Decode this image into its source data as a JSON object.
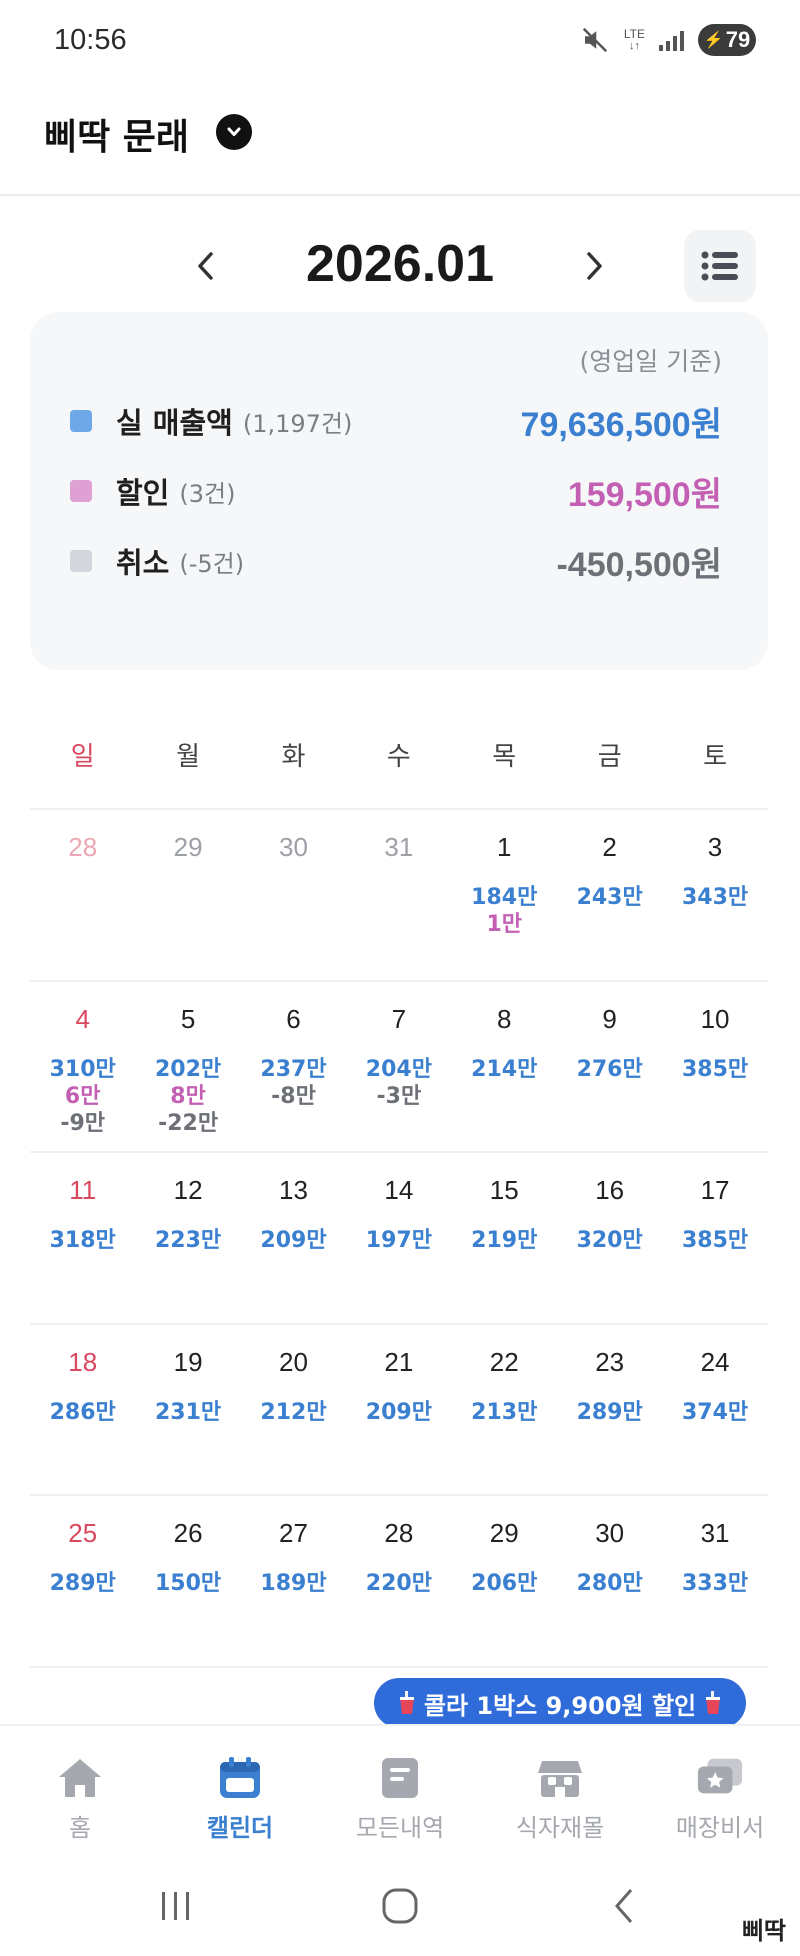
{
  "status_bar": {
    "time": "10:56",
    "network": "LTE",
    "battery": "79",
    "icons": [
      "mute-icon",
      "lte-icon",
      "signal-icon",
      "battery-charging-icon"
    ]
  },
  "header": {
    "store_name": "삐딱 문래",
    "toggle_icon": "chevron-down-icon"
  },
  "month_nav": {
    "label": "2026.01",
    "prev_icon": "chevron-left-icon",
    "next_icon": "chevron-right-icon",
    "list_icon": "list-view-icon"
  },
  "summary": {
    "note": "(영업일 기준)",
    "rows": [
      {
        "label": "실 매출액",
        "count": "(1,197건)",
        "value": "79,636,500원",
        "color": "#3a7fd0",
        "swatch": "#6ea8e8"
      },
      {
        "label": "할인",
        "count": "(3건)",
        "value": "159,500원",
        "color": "#c360b4",
        "swatch": "#dfa0d4"
      },
      {
        "label": "취소",
        "count": "(-5건)",
        "value": "-450,500원",
        "color": "#6e7078",
        "swatch": "#d4d6de"
      }
    ]
  },
  "calendar": {
    "weekdays": [
      "일",
      "월",
      "화",
      "수",
      "목",
      "금",
      "토"
    ],
    "weeks": [
      [
        {
          "day": "28",
          "muted": true
        },
        {
          "day": "29",
          "muted": true
        },
        {
          "day": "30",
          "muted": true
        },
        {
          "day": "31",
          "muted": true
        },
        {
          "day": "1",
          "sales": "184만",
          "discount": "1만"
        },
        {
          "day": "2",
          "sales": "243만"
        },
        {
          "day": "3",
          "sales": "343만"
        }
      ],
      [
        {
          "day": "4",
          "sales": "310만",
          "discount": "6만",
          "cancel": "-9만"
        },
        {
          "day": "5",
          "sales": "202만",
          "discount": "8만",
          "cancel": "-22만"
        },
        {
          "day": "6",
          "sales": "237만",
          "cancel": "-8만"
        },
        {
          "day": "7",
          "sales": "204만",
          "cancel": "-3만"
        },
        {
          "day": "8",
          "sales": "214만"
        },
        {
          "day": "9",
          "sales": "276만"
        },
        {
          "day": "10",
          "sales": "385만"
        }
      ],
      [
        {
          "day": "11",
          "sales": "318만"
        },
        {
          "day": "12",
          "sales": "223만"
        },
        {
          "day": "13",
          "sales": "209만"
        },
        {
          "day": "14",
          "sales": "197만"
        },
        {
          "day": "15",
          "sales": "219만"
        },
        {
          "day": "16",
          "sales": "320만"
        },
        {
          "day": "17",
          "sales": "385만"
        }
      ],
      [
        {
          "day": "18",
          "sales": "286만"
        },
        {
          "day": "19",
          "sales": "231만"
        },
        {
          "day": "20",
          "sales": "212만"
        },
        {
          "day": "21",
          "sales": "209만"
        },
        {
          "day": "22",
          "sales": "213만"
        },
        {
          "day": "23",
          "sales": "289만"
        },
        {
          "day": "24",
          "sales": "374만"
        }
      ],
      [
        {
          "day": "25",
          "sales": "289만"
        },
        {
          "day": "26",
          "sales": "150만"
        },
        {
          "day": "27",
          "sales": "189만"
        },
        {
          "day": "28",
          "sales": "220만"
        },
        {
          "day": "29",
          "sales": "206만"
        },
        {
          "day": "30",
          "sales": "280만"
        },
        {
          "day": "31",
          "sales": "333만"
        }
      ]
    ]
  },
  "promo": {
    "text": "콜라 1박스 9,900원 할인",
    "icon": "cola-cup-icon"
  },
  "bottom_nav": {
    "items": [
      {
        "label": "홈",
        "icon": "home-icon",
        "active": false
      },
      {
        "label": "캘린더",
        "icon": "calendar-icon",
        "active": true
      },
      {
        "label": "모든내역",
        "icon": "receipt-icon",
        "active": false
      },
      {
        "label": "식자재몰",
        "icon": "store-icon",
        "active": false
      },
      {
        "label": "매장비서",
        "icon": "chat-star-icon",
        "active": false
      }
    ]
  },
  "system_nav": {
    "icons": [
      "recent-apps-icon",
      "home-circle-icon",
      "back-icon"
    ]
  },
  "watermark": "삐딱",
  "colors": {
    "accent": "#3a7fd0",
    "discount": "#c360b4",
    "cancel": "#6e7078",
    "sunday": "#d9485f",
    "promo": "#2f6bd9"
  }
}
